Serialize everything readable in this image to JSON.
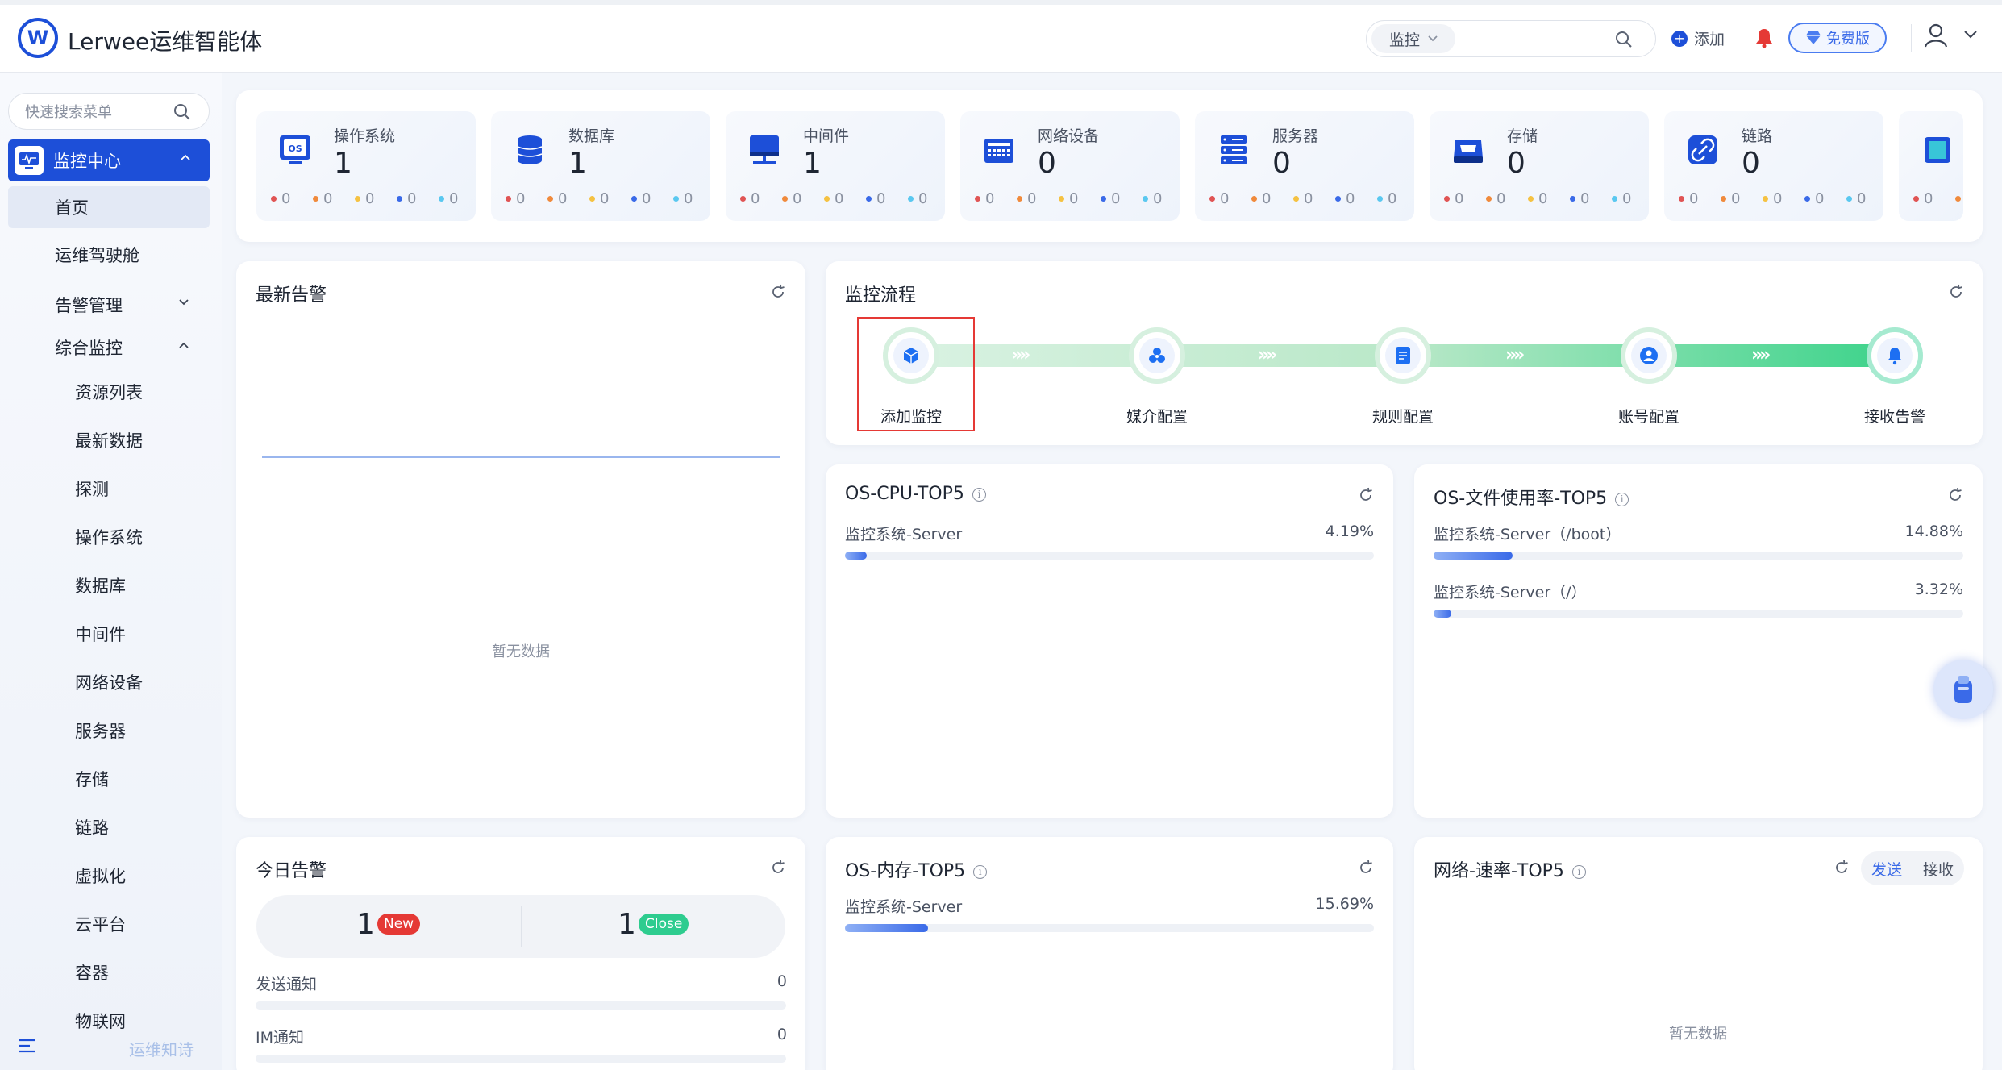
{
  "app": {
    "title": "Lerwee运维智能体",
    "logo_letter": "W"
  },
  "header": {
    "search_scope": "监控",
    "add_label": "添加",
    "plan_label": "免费版"
  },
  "sidebar": {
    "search_placeholder": "快速搜索菜单",
    "active_group": "监控中心",
    "home": "首页",
    "items": [
      "运维驾驶舱",
      "告警管理",
      "综合监控"
    ],
    "sub_items": [
      "资源列表",
      "最新数据",
      "探测",
      "操作系统",
      "数据库",
      "中间件",
      "网络设备",
      "服务器",
      "存储",
      "链路",
      "虚拟化",
      "云平台",
      "容器",
      "物联网"
    ],
    "footer_text": "运维知诗"
  },
  "categories": [
    {
      "name": "操作系统",
      "count": "1",
      "icon": "os-icon"
    },
    {
      "name": "数据库",
      "count": "1",
      "icon": "database-icon"
    },
    {
      "name": "中间件",
      "count": "1",
      "icon": "middleware-icon"
    },
    {
      "name": "网络设备",
      "count": "0",
      "icon": "network-device-icon"
    },
    {
      "name": "服务器",
      "count": "0",
      "icon": "server-icon"
    },
    {
      "name": "存储",
      "count": "0",
      "icon": "storage-icon"
    },
    {
      "name": "链路",
      "count": "0",
      "icon": "link-icon"
    }
  ],
  "severity_counts": [
    "0",
    "0",
    "0",
    "0",
    "0"
  ],
  "severity_colors": [
    "#e05454",
    "#f08a3c",
    "#f5c242",
    "#3a6ae8",
    "#5ac8f0"
  ],
  "latest_alerts": {
    "title": "最新告警",
    "empty": "暂无数据"
  },
  "flow": {
    "title": "监控流程",
    "steps": [
      "添加监控",
      "媒介配置",
      "规则配置",
      "账号配置",
      "接收告警"
    ]
  },
  "cpu_top5": {
    "title": "OS-CPU-TOP5",
    "rows": [
      {
        "label": "监控系统-Server",
        "value": "4.19%",
        "pct": 4.19
      }
    ]
  },
  "fs_top5": {
    "title": "OS-文件使用率-TOP5",
    "rows": [
      {
        "label": "监控系统-Server（/boot）",
        "value": "14.88%",
        "pct": 14.88
      },
      {
        "label": "监控系统-Server（/）",
        "value": "3.32%",
        "pct": 3.32
      }
    ]
  },
  "today_alerts": {
    "title": "今日告警",
    "new_count": "1",
    "new_label": "New",
    "close_count": "1",
    "close_label": "Close",
    "send_notify_label": "发送通知",
    "send_notify_value": "0",
    "im_notify_label": "IM通知",
    "im_notify_value": "0"
  },
  "mem_top5": {
    "title": "OS-内存-TOP5",
    "rows": [
      {
        "label": "监控系统-Server",
        "value": "15.69%",
        "pct": 15.69
      }
    ]
  },
  "net_top5": {
    "title": "网络-速率-TOP5",
    "tab_send": "发送",
    "tab_recv": "接收",
    "empty": "暂无数据"
  },
  "colors": {
    "primary": "#1d4fd8",
    "flow_green": "#3bd38a",
    "new_badge": "#e53935",
    "close_badge": "#2ecc8f"
  }
}
